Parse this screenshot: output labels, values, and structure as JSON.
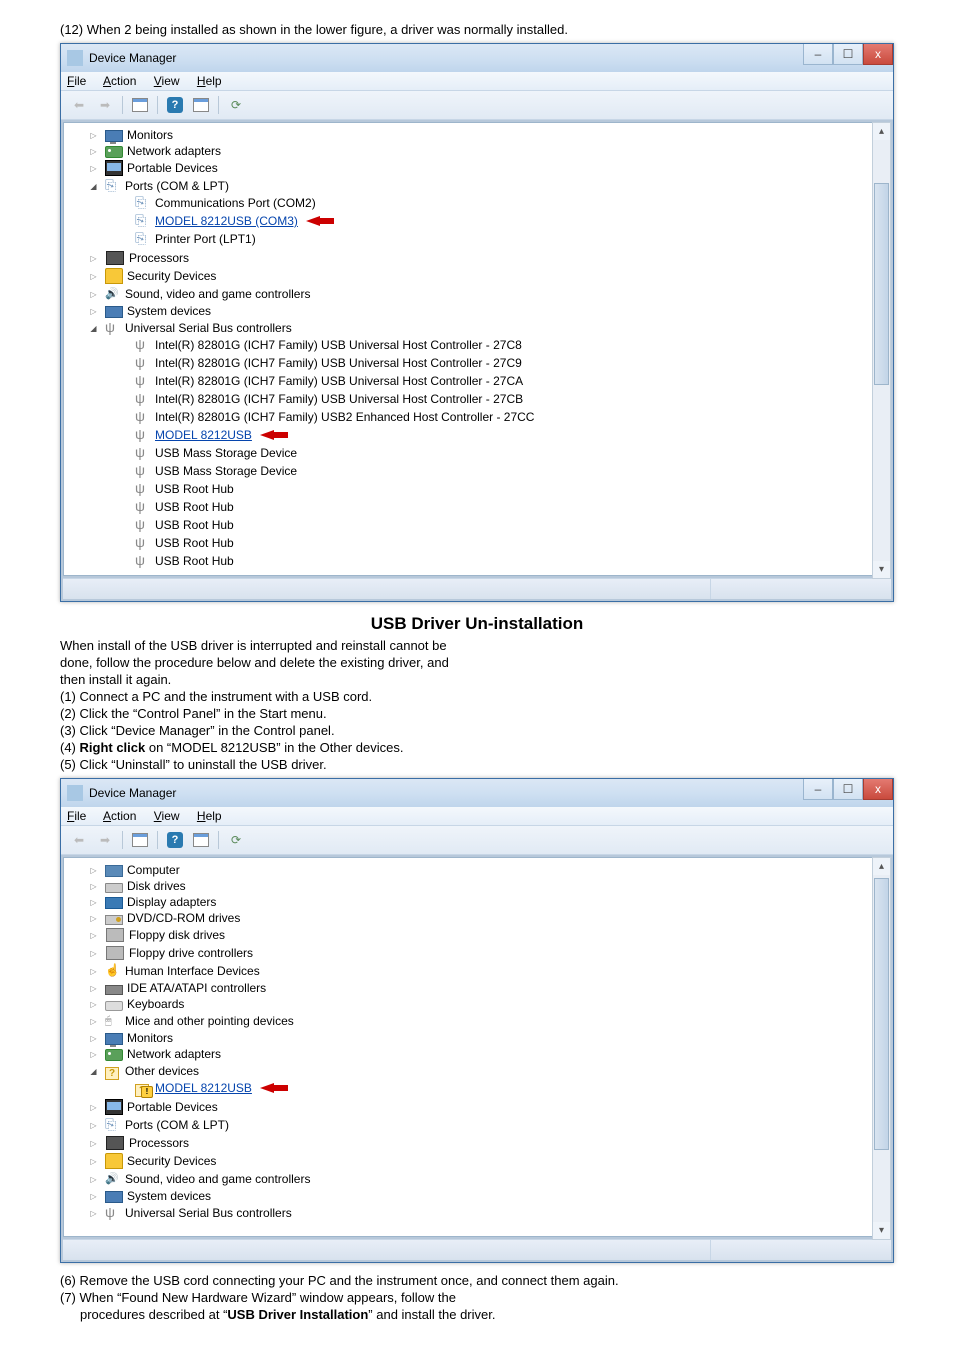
{
  "doc": {
    "line12": "(12)  When 2 being installed as shown in the lower figure, a driver was normally installed.",
    "uninstall_title": "USB Driver Un-installation",
    "uninstall_intro1": "When install of the USB driver is interrupted and reinstall cannot be",
    "uninstall_intro2": "done, follow the procedure below and delete the existing driver, and",
    "uninstall_intro3": "then install it again.",
    "step1": "(1)  Connect a PC and the instrument with a USB cord.",
    "step2": "(2)  Click the “Control Panel” in the Start menu.",
    "step3": "(3)  Click “Device Manager” in the Control panel.",
    "step4a": "(4)  ",
    "step4b": "Right click",
    "step4c": " on “MODEL 8212USB” in the Other devices.",
    "step5": "(5)  Click “Uninstall” to uninstall the USB driver.",
    "step6": "(6)  Remove the USB cord connecting your PC and the instrument once, and connect them again.",
    "step7a": "(7)  When “Found New Hardware Wizard” window appears, follow the",
    "step7b_pre": "procedures described at “",
    "step7b_bold": "USB Driver Installation",
    "step7b_post": "” and install the driver."
  },
  "win": {
    "title": "Device Manager",
    "menu": {
      "file": "File",
      "action": "Action",
      "view": "View",
      "help": "Help"
    },
    "btn": {
      "min": "–",
      "max": "☐",
      "close": "x"
    }
  },
  "tree1": {
    "items": [
      {
        "exp": "closed",
        "icon": "icon-monitor",
        "label": "Monitors"
      },
      {
        "exp": "closed",
        "icon": "icon-network",
        "label": "Network adapters"
      },
      {
        "exp": "closed",
        "icon": "icon-portable",
        "label": "Portable Devices"
      },
      {
        "exp": "open",
        "icon": "icon-port",
        "label": "Ports (COM & LPT)"
      }
    ],
    "ports_children": [
      {
        "label": "Communications Port (COM2)"
      },
      {
        "label": "MODEL 8212USB (COM3)",
        "hl": true,
        "arrow": true
      },
      {
        "label": "Printer Port (LPT1)"
      }
    ],
    "items2": [
      {
        "exp": "closed",
        "icon": "icon-proc",
        "label": "Processors"
      },
      {
        "exp": "closed",
        "icon": "icon-security",
        "label": "Security Devices"
      },
      {
        "exp": "closed",
        "icon": "icon-sound",
        "label": "Sound, video and game controllers"
      },
      {
        "exp": "closed",
        "icon": "icon-system",
        "label": "System devices"
      },
      {
        "exp": "open",
        "icon": "icon-usb",
        "label": "Universal Serial Bus controllers"
      }
    ],
    "usb_children": [
      {
        "label": "Intel(R) 82801G (ICH7 Family) USB Universal Host Controller - 27C8"
      },
      {
        "label": "Intel(R) 82801G (ICH7 Family) USB Universal Host Controller - 27C9"
      },
      {
        "label": "Intel(R) 82801G (ICH7 Family) USB Universal Host Controller - 27CA"
      },
      {
        "label": "Intel(R) 82801G (ICH7 Family) USB Universal Host Controller - 27CB"
      },
      {
        "label": "Intel(R) 82801G (ICH7 Family) USB2 Enhanced Host Controller - 27CC"
      },
      {
        "label": "MODEL 8212USB",
        "hl": true,
        "arrow": true
      },
      {
        "label": "USB Mass Storage Device"
      },
      {
        "label": "USB Mass Storage Device"
      },
      {
        "label": "USB Root Hub"
      },
      {
        "label": "USB Root Hub"
      },
      {
        "label": "USB Root Hub"
      },
      {
        "label": "USB Root Hub"
      },
      {
        "label": "USB Root Hub"
      }
    ]
  },
  "tree2": {
    "items": [
      {
        "exp": "closed",
        "icon": "icon-computer",
        "label": "Computer"
      },
      {
        "exp": "closed",
        "icon": "icon-disk",
        "label": "Disk drives"
      },
      {
        "exp": "closed",
        "icon": "icon-display",
        "label": "Display adapters"
      },
      {
        "exp": "closed",
        "icon": "icon-dvd",
        "label": "DVD/CD-ROM drives"
      },
      {
        "exp": "closed",
        "icon": "icon-floppy",
        "label": "Floppy disk drives"
      },
      {
        "exp": "closed",
        "icon": "icon-floppy",
        "label": "Floppy drive controllers"
      },
      {
        "exp": "closed",
        "icon": "icon-hid",
        "label": "Human Interface Devices"
      },
      {
        "exp": "closed",
        "icon": "icon-ide",
        "label": "IDE ATA/ATAPI controllers"
      },
      {
        "exp": "closed",
        "icon": "icon-keyboard",
        "label": "Keyboards"
      },
      {
        "exp": "closed",
        "icon": "icon-mouse",
        "label": "Mice and other pointing devices"
      },
      {
        "exp": "closed",
        "icon": "icon-monitor",
        "label": "Monitors"
      },
      {
        "exp": "closed",
        "icon": "icon-network",
        "label": "Network adapters"
      },
      {
        "exp": "open",
        "icon": "icon-other",
        "label": "Other devices"
      }
    ],
    "other_children": [
      {
        "label": "MODEL 8212USB",
        "hl": true,
        "arrow": true,
        "warn": true
      }
    ],
    "items2": [
      {
        "exp": "closed",
        "icon": "icon-portable",
        "label": "Portable Devices"
      },
      {
        "exp": "closed",
        "icon": "icon-port",
        "label": "Ports (COM & LPT)"
      },
      {
        "exp": "closed",
        "icon": "icon-proc",
        "label": "Processors"
      },
      {
        "exp": "closed",
        "icon": "icon-security",
        "label": "Security Devices"
      },
      {
        "exp": "closed",
        "icon": "icon-sound",
        "label": "Sound, video and game controllers"
      },
      {
        "exp": "closed",
        "icon": "icon-system",
        "label": "System devices"
      },
      {
        "exp": "closed",
        "icon": "icon-usb",
        "label": "Universal Serial Bus controllers"
      }
    ]
  }
}
